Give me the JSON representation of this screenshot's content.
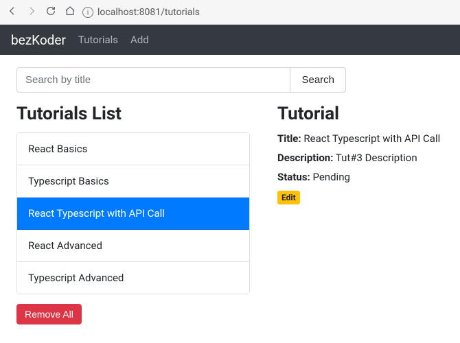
{
  "browser": {
    "url": "localhost:8081/tutorials"
  },
  "navbar": {
    "brand": "bezKoder",
    "links": [
      "Tutorials",
      "Add"
    ]
  },
  "search": {
    "placeholder": "Search by title",
    "button_label": "Search"
  },
  "list": {
    "heading": "Tutorials List",
    "items": [
      {
        "name": "React Basics",
        "active": false
      },
      {
        "name": "Typescript Basics",
        "active": false
      },
      {
        "name": "React Typescript with API Call",
        "active": true
      },
      {
        "name": "React Advanced",
        "active": false
      },
      {
        "name": "Typescript Advanced",
        "active": false
      }
    ],
    "remove_all_label": "Remove All"
  },
  "detail": {
    "heading": "Tutorial",
    "title_label": "Title:",
    "title_value": "React Typescript with API Call",
    "description_label": "Description:",
    "description_value": "Tut#3 Description",
    "status_label": "Status:",
    "status_value": "Pending",
    "edit_label": "Edit"
  }
}
